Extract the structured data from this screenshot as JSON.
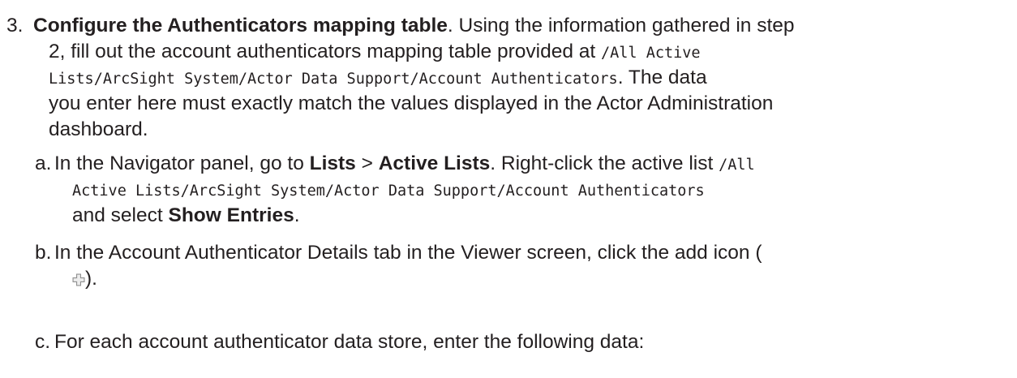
{
  "step3": {
    "number": "3.",
    "title": "Configure the Authenticators mapping table",
    "l1_after": ". Using the information gathered in step",
    "l2_text": "2, fill out the account authenticators mapping table provided at ",
    "l2_code": "/All Active",
    "l3_code": "Lists/ArcSight System/Actor Data Support/Account Authenticators",
    "l3_after": ". The data",
    "l4": "you enter here must exactly match the values displayed in the Actor Administration",
    "l5": "dashboard."
  },
  "substeps": {
    "a": {
      "letter": "a.",
      "l1_text": "In the Navigator panel, go to ",
      "lists": "Lists",
      "sep": " > ",
      "active_lists": "Active Lists",
      "l1_after": ". Right-click the active list ",
      "l1_code": "/All",
      "l2_code": "Active Lists/ArcSight System/Actor Data Support/Account Authenticators",
      "l3_text": "and select ",
      "show_entries": "Show Entries",
      "l3_after": "."
    },
    "b": {
      "letter": "b.",
      "l1": "In the Account Authenticator Details tab in the Viewer screen, click the add icon (",
      "l2_after": ").",
      "icon": "add-icon"
    },
    "c": {
      "letter": "c.",
      "l1": "For each account authenticator data store, enter the following data:"
    }
  }
}
